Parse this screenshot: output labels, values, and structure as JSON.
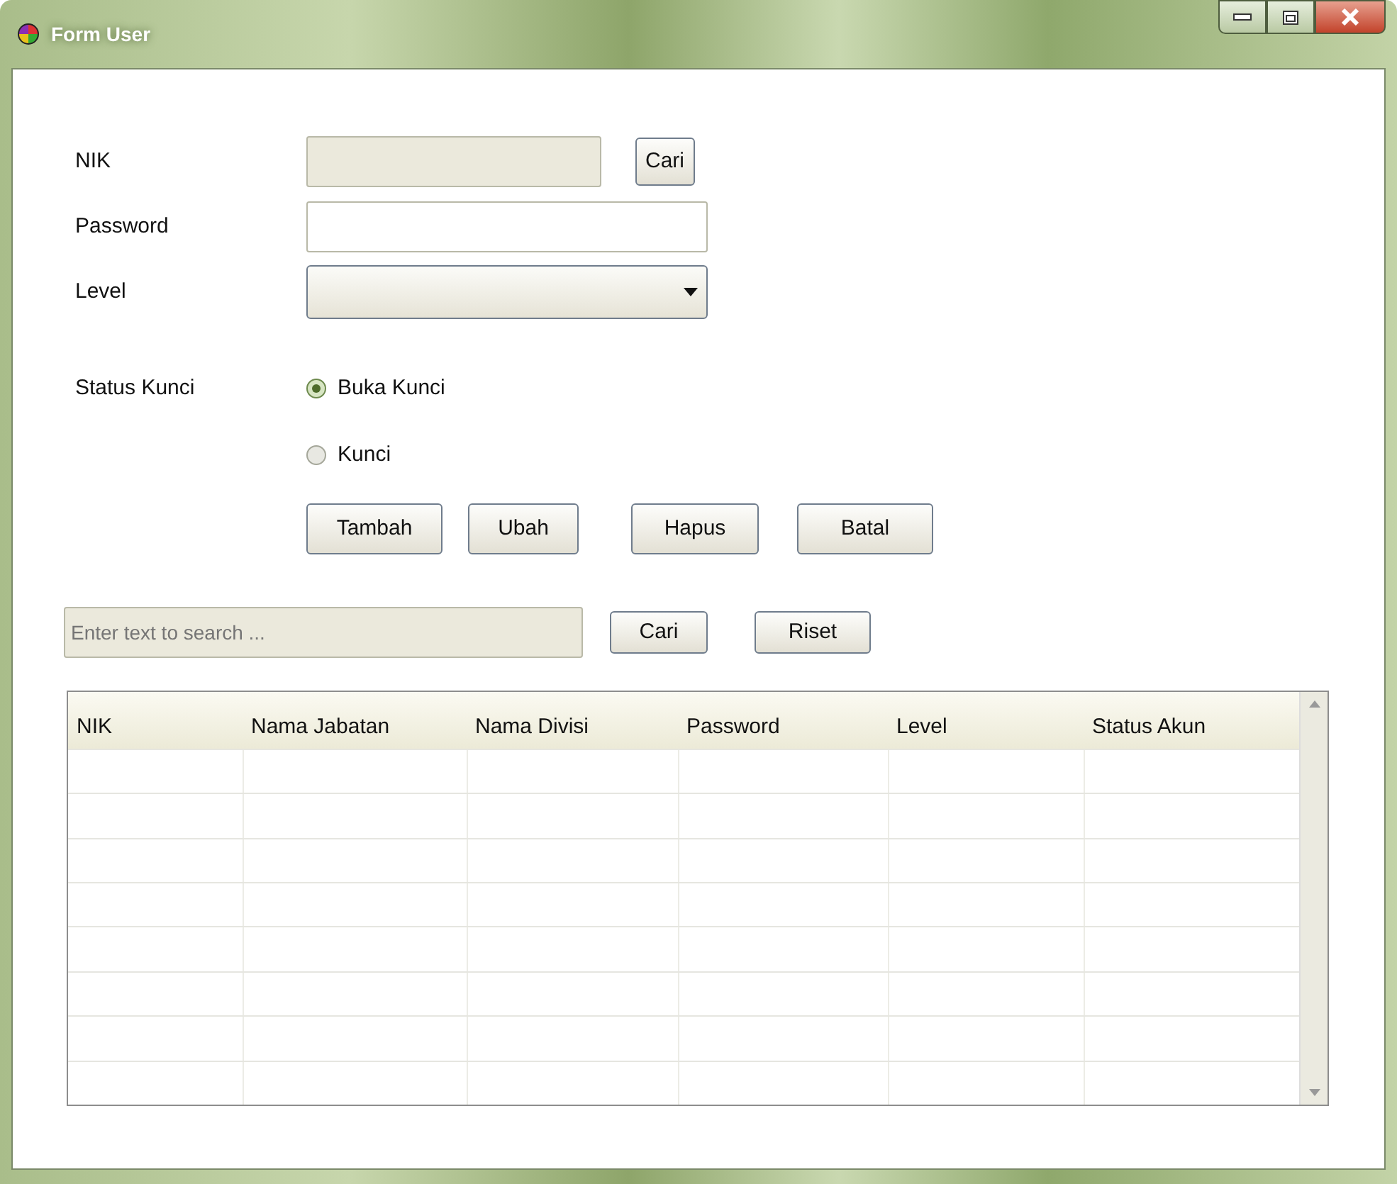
{
  "window": {
    "title": "Form User"
  },
  "form": {
    "fields": [
      {
        "kind": "text",
        "label": "NIK",
        "disabled": true,
        "button": "Cari"
      },
      {
        "kind": "text",
        "label": "Password",
        "disabled": false
      },
      {
        "kind": "select",
        "label": "Level"
      }
    ],
    "status": {
      "label": "Status Kunci",
      "options": [
        {
          "label": "Buka Kunci",
          "selected": true
        },
        {
          "label": "Kunci",
          "selected": false
        }
      ]
    },
    "buttons": [
      "Tambah",
      "Ubah",
      "Hapus",
      "Batal"
    ]
  },
  "search": {
    "placeholder": "Enter text to search ...",
    "buttons": [
      "Cari",
      "Riset"
    ]
  },
  "table": {
    "columns": [
      "NIK",
      "Nama Jabatan",
      "Nama Divisi",
      "Password",
      "Level",
      "Status Akun"
    ]
  }
}
